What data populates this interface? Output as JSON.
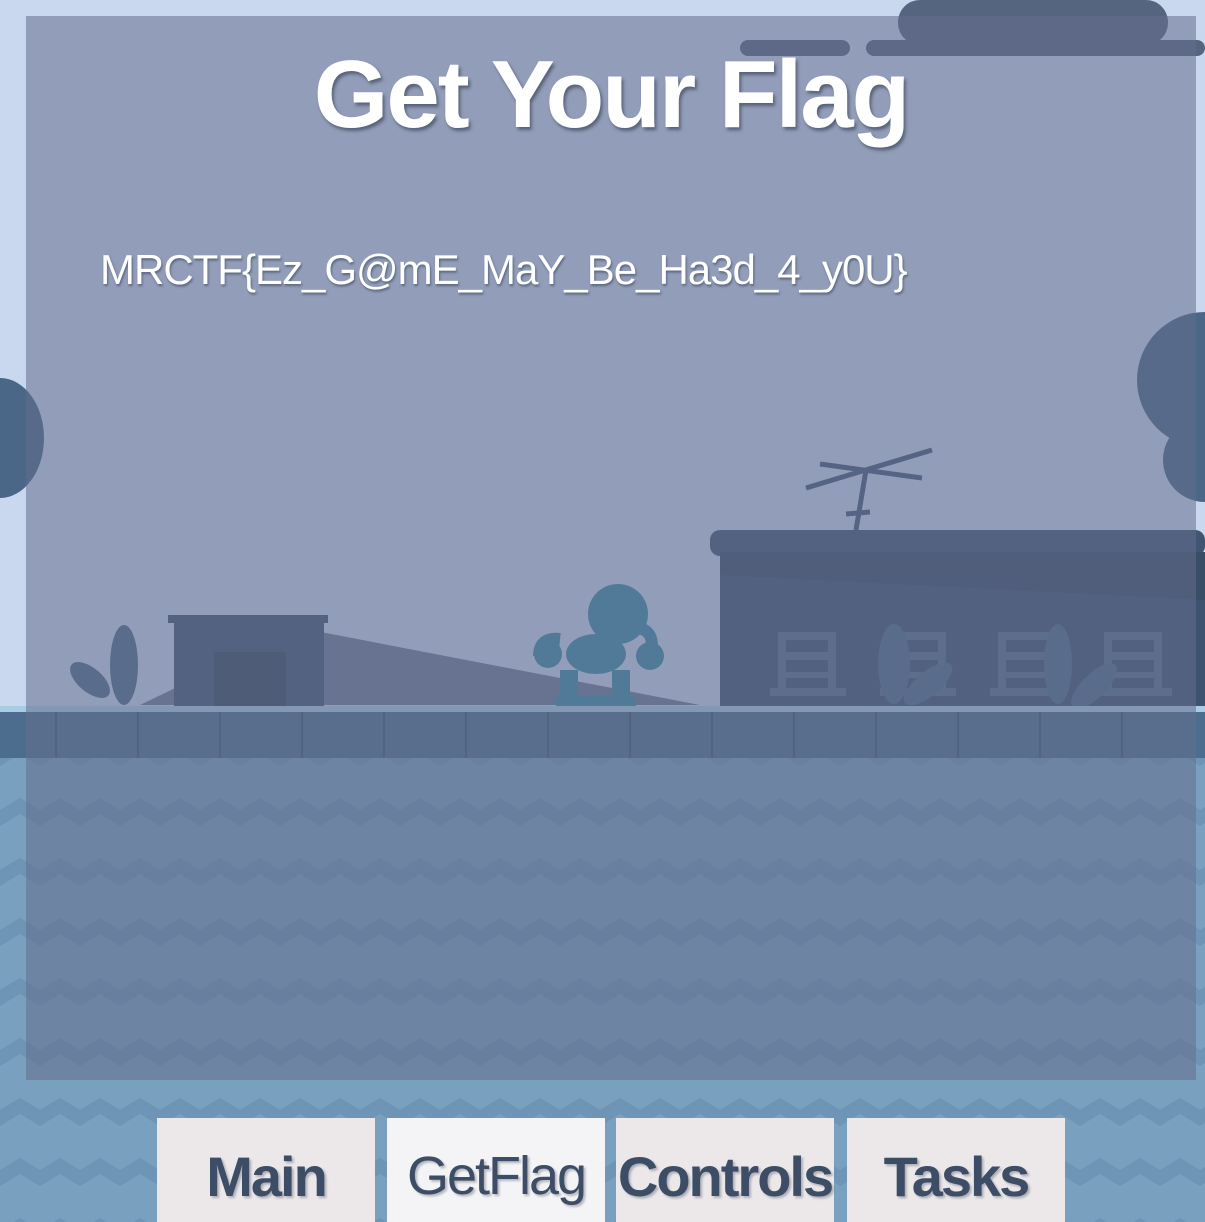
{
  "screen": {
    "title": "Get Your Flag",
    "flag": "MRCTF{Ez_G@mE_MaY_Be_Ha3d_4_y0U}"
  },
  "tabs": [
    {
      "label": "Main",
      "active": false
    },
    {
      "label": "GetFlag",
      "active": true
    },
    {
      "label": "Controls",
      "active": false
    },
    {
      "label": "Tasks",
      "active": false
    }
  ],
  "colors": {
    "sky": "#c9d8ef",
    "water": "#7aa0bf",
    "panel_overlay": "#646e8c",
    "building": "#3f5572",
    "character": "#3b8aa6",
    "tab_bg": "#ece8ea",
    "tab_text": "#3d4d66"
  }
}
